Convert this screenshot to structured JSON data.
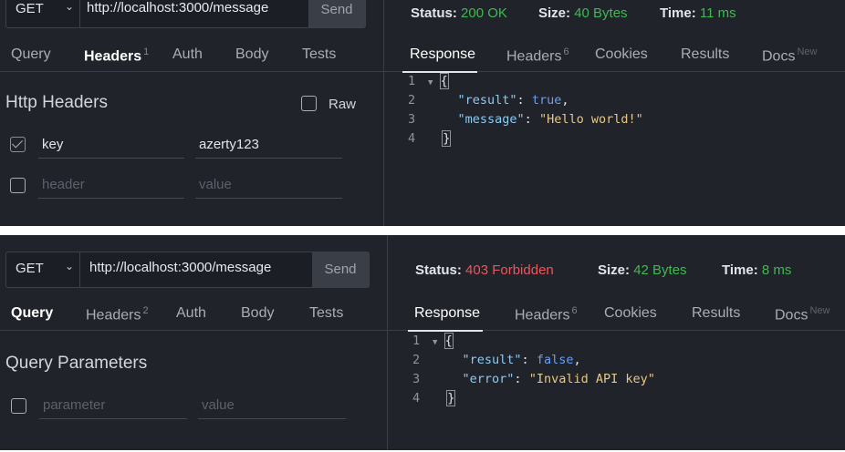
{
  "panels": [
    {
      "request": {
        "method": "GET",
        "url": "http://localhost:3000/message",
        "send_label": "Send"
      },
      "request_tabs": [
        {
          "label": "Query",
          "count": ""
        },
        {
          "label": "Headers",
          "count": "1"
        },
        {
          "label": "Auth",
          "count": ""
        },
        {
          "label": "Body",
          "count": ""
        },
        {
          "label": "Tests",
          "count": ""
        }
      ],
      "active_request_tab": "Headers",
      "section_title": "Http Headers",
      "raw_label": "Raw",
      "rows": [
        {
          "checked": true,
          "name": "key",
          "value": "azerty123"
        },
        {
          "checked": false,
          "name_placeholder": "header",
          "value_placeholder": "value"
        }
      ],
      "status": {
        "status_label": "Status:",
        "status_value": "200 OK",
        "status_color": "#3fba50",
        "size_label": "Size:",
        "size_value": "40 Bytes",
        "time_label": "Time:",
        "time_value": "11 ms"
      },
      "response_tabs": [
        {
          "label": "Response",
          "count": ""
        },
        {
          "label": "Headers",
          "count": "6"
        },
        {
          "label": "Cookies",
          "count": ""
        },
        {
          "label": "Results",
          "count": ""
        },
        {
          "label": "Docs",
          "count": "New"
        }
      ],
      "body_lines": [
        {
          "num": "1",
          "text": "{"
        },
        {
          "num": "2",
          "key": "\"result\"",
          "value": "true",
          "type": "bool",
          "comma": ","
        },
        {
          "num": "3",
          "key": "\"message\"",
          "value": "\"Hello world!\"",
          "type": "string",
          "comma": ""
        },
        {
          "num": "4",
          "text": "}"
        }
      ]
    },
    {
      "request": {
        "method": "GET",
        "url": "http://localhost:3000/message",
        "send_label": "Send"
      },
      "request_tabs": [
        {
          "label": "Query",
          "count": ""
        },
        {
          "label": "Headers",
          "count": "2"
        },
        {
          "label": "Auth",
          "count": ""
        },
        {
          "label": "Body",
          "count": ""
        },
        {
          "label": "Tests",
          "count": ""
        }
      ],
      "active_request_tab": "Query",
      "section_title": "Query Parameters",
      "rows": [
        {
          "checked": false,
          "name_placeholder": "parameter",
          "value_placeholder": "value"
        }
      ],
      "status": {
        "status_label": "Status:",
        "status_value": "403 Forbidden",
        "status_color": "#f4525a",
        "size_label": "Size:",
        "size_value": "42 Bytes",
        "time_label": "Time:",
        "time_value": "8 ms"
      },
      "response_tabs": [
        {
          "label": "Response",
          "count": ""
        },
        {
          "label": "Headers",
          "count": "6"
        },
        {
          "label": "Cookies",
          "count": ""
        },
        {
          "label": "Results",
          "count": ""
        },
        {
          "label": "Docs",
          "count": "New"
        }
      ],
      "body_lines": [
        {
          "num": "1",
          "text": "{"
        },
        {
          "num": "2",
          "key": "\"result\"",
          "value": "false",
          "type": "bool",
          "comma": ","
        },
        {
          "num": "3",
          "key": "\"error\"",
          "value": "\"Invalid API key\"",
          "type": "string",
          "comma": ""
        },
        {
          "num": "4",
          "text": "}"
        }
      ]
    }
  ],
  "icons": {
    "method_dropdown": "chevron-down-icon",
    "fold": "fold-arrow-icon",
    "checkbox": "checkbox-icon"
  },
  "colors": {
    "background": "#20232a",
    "success": "#3fba50",
    "error": "#f4525a",
    "json_key": "#8ccbf2",
    "json_string": "#e7c787",
    "json_bool": "#6a9ef5"
  }
}
